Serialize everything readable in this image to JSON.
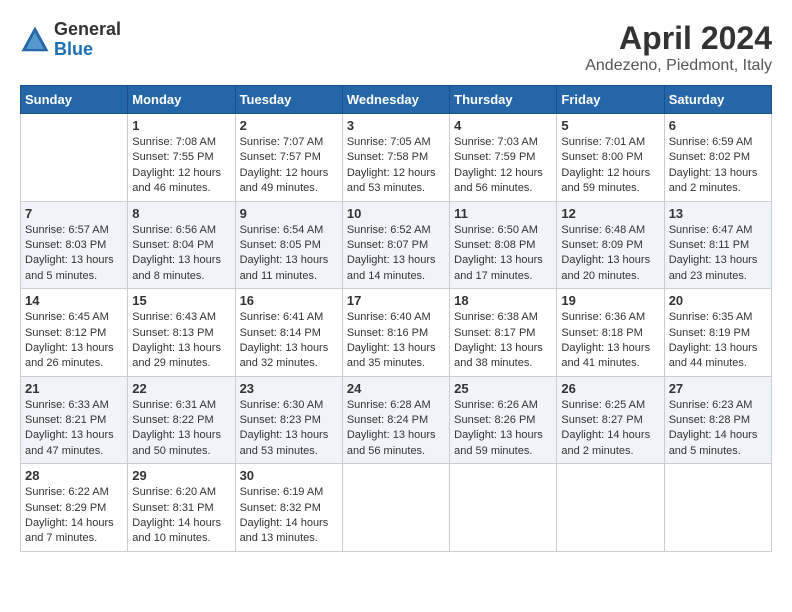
{
  "header": {
    "logo_general": "General",
    "logo_blue": "Blue",
    "month": "April 2024",
    "location": "Andezeno, Piedmont, Italy"
  },
  "days_of_week": [
    "Sunday",
    "Monday",
    "Tuesday",
    "Wednesday",
    "Thursday",
    "Friday",
    "Saturday"
  ],
  "weeks": [
    [
      {
        "day": "",
        "info": ""
      },
      {
        "day": "1",
        "info": "Sunrise: 7:08 AM\nSunset: 7:55 PM\nDaylight: 12 hours\nand 46 minutes."
      },
      {
        "day": "2",
        "info": "Sunrise: 7:07 AM\nSunset: 7:57 PM\nDaylight: 12 hours\nand 49 minutes."
      },
      {
        "day": "3",
        "info": "Sunrise: 7:05 AM\nSunset: 7:58 PM\nDaylight: 12 hours\nand 53 minutes."
      },
      {
        "day": "4",
        "info": "Sunrise: 7:03 AM\nSunset: 7:59 PM\nDaylight: 12 hours\nand 56 minutes."
      },
      {
        "day": "5",
        "info": "Sunrise: 7:01 AM\nSunset: 8:00 PM\nDaylight: 12 hours\nand 59 minutes."
      },
      {
        "day": "6",
        "info": "Sunrise: 6:59 AM\nSunset: 8:02 PM\nDaylight: 13 hours\nand 2 minutes."
      }
    ],
    [
      {
        "day": "7",
        "info": "Sunrise: 6:57 AM\nSunset: 8:03 PM\nDaylight: 13 hours\nand 5 minutes."
      },
      {
        "day": "8",
        "info": "Sunrise: 6:56 AM\nSunset: 8:04 PM\nDaylight: 13 hours\nand 8 minutes."
      },
      {
        "day": "9",
        "info": "Sunrise: 6:54 AM\nSunset: 8:05 PM\nDaylight: 13 hours\nand 11 minutes."
      },
      {
        "day": "10",
        "info": "Sunrise: 6:52 AM\nSunset: 8:07 PM\nDaylight: 13 hours\nand 14 minutes."
      },
      {
        "day": "11",
        "info": "Sunrise: 6:50 AM\nSunset: 8:08 PM\nDaylight: 13 hours\nand 17 minutes."
      },
      {
        "day": "12",
        "info": "Sunrise: 6:48 AM\nSunset: 8:09 PM\nDaylight: 13 hours\nand 20 minutes."
      },
      {
        "day": "13",
        "info": "Sunrise: 6:47 AM\nSunset: 8:11 PM\nDaylight: 13 hours\nand 23 minutes."
      }
    ],
    [
      {
        "day": "14",
        "info": "Sunrise: 6:45 AM\nSunset: 8:12 PM\nDaylight: 13 hours\nand 26 minutes."
      },
      {
        "day": "15",
        "info": "Sunrise: 6:43 AM\nSunset: 8:13 PM\nDaylight: 13 hours\nand 29 minutes."
      },
      {
        "day": "16",
        "info": "Sunrise: 6:41 AM\nSunset: 8:14 PM\nDaylight: 13 hours\nand 32 minutes."
      },
      {
        "day": "17",
        "info": "Sunrise: 6:40 AM\nSunset: 8:16 PM\nDaylight: 13 hours\nand 35 minutes."
      },
      {
        "day": "18",
        "info": "Sunrise: 6:38 AM\nSunset: 8:17 PM\nDaylight: 13 hours\nand 38 minutes."
      },
      {
        "day": "19",
        "info": "Sunrise: 6:36 AM\nSunset: 8:18 PM\nDaylight: 13 hours\nand 41 minutes."
      },
      {
        "day": "20",
        "info": "Sunrise: 6:35 AM\nSunset: 8:19 PM\nDaylight: 13 hours\nand 44 minutes."
      }
    ],
    [
      {
        "day": "21",
        "info": "Sunrise: 6:33 AM\nSunset: 8:21 PM\nDaylight: 13 hours\nand 47 minutes."
      },
      {
        "day": "22",
        "info": "Sunrise: 6:31 AM\nSunset: 8:22 PM\nDaylight: 13 hours\nand 50 minutes."
      },
      {
        "day": "23",
        "info": "Sunrise: 6:30 AM\nSunset: 8:23 PM\nDaylight: 13 hours\nand 53 minutes."
      },
      {
        "day": "24",
        "info": "Sunrise: 6:28 AM\nSunset: 8:24 PM\nDaylight: 13 hours\nand 56 minutes."
      },
      {
        "day": "25",
        "info": "Sunrise: 6:26 AM\nSunset: 8:26 PM\nDaylight: 13 hours\nand 59 minutes."
      },
      {
        "day": "26",
        "info": "Sunrise: 6:25 AM\nSunset: 8:27 PM\nDaylight: 14 hours\nand 2 minutes."
      },
      {
        "day": "27",
        "info": "Sunrise: 6:23 AM\nSunset: 8:28 PM\nDaylight: 14 hours\nand 5 minutes."
      }
    ],
    [
      {
        "day": "28",
        "info": "Sunrise: 6:22 AM\nSunset: 8:29 PM\nDaylight: 14 hours\nand 7 minutes."
      },
      {
        "day": "29",
        "info": "Sunrise: 6:20 AM\nSunset: 8:31 PM\nDaylight: 14 hours\nand 10 minutes."
      },
      {
        "day": "30",
        "info": "Sunrise: 6:19 AM\nSunset: 8:32 PM\nDaylight: 14 hours\nand 13 minutes."
      },
      {
        "day": "",
        "info": ""
      },
      {
        "day": "",
        "info": ""
      },
      {
        "day": "",
        "info": ""
      },
      {
        "day": "",
        "info": ""
      }
    ]
  ]
}
